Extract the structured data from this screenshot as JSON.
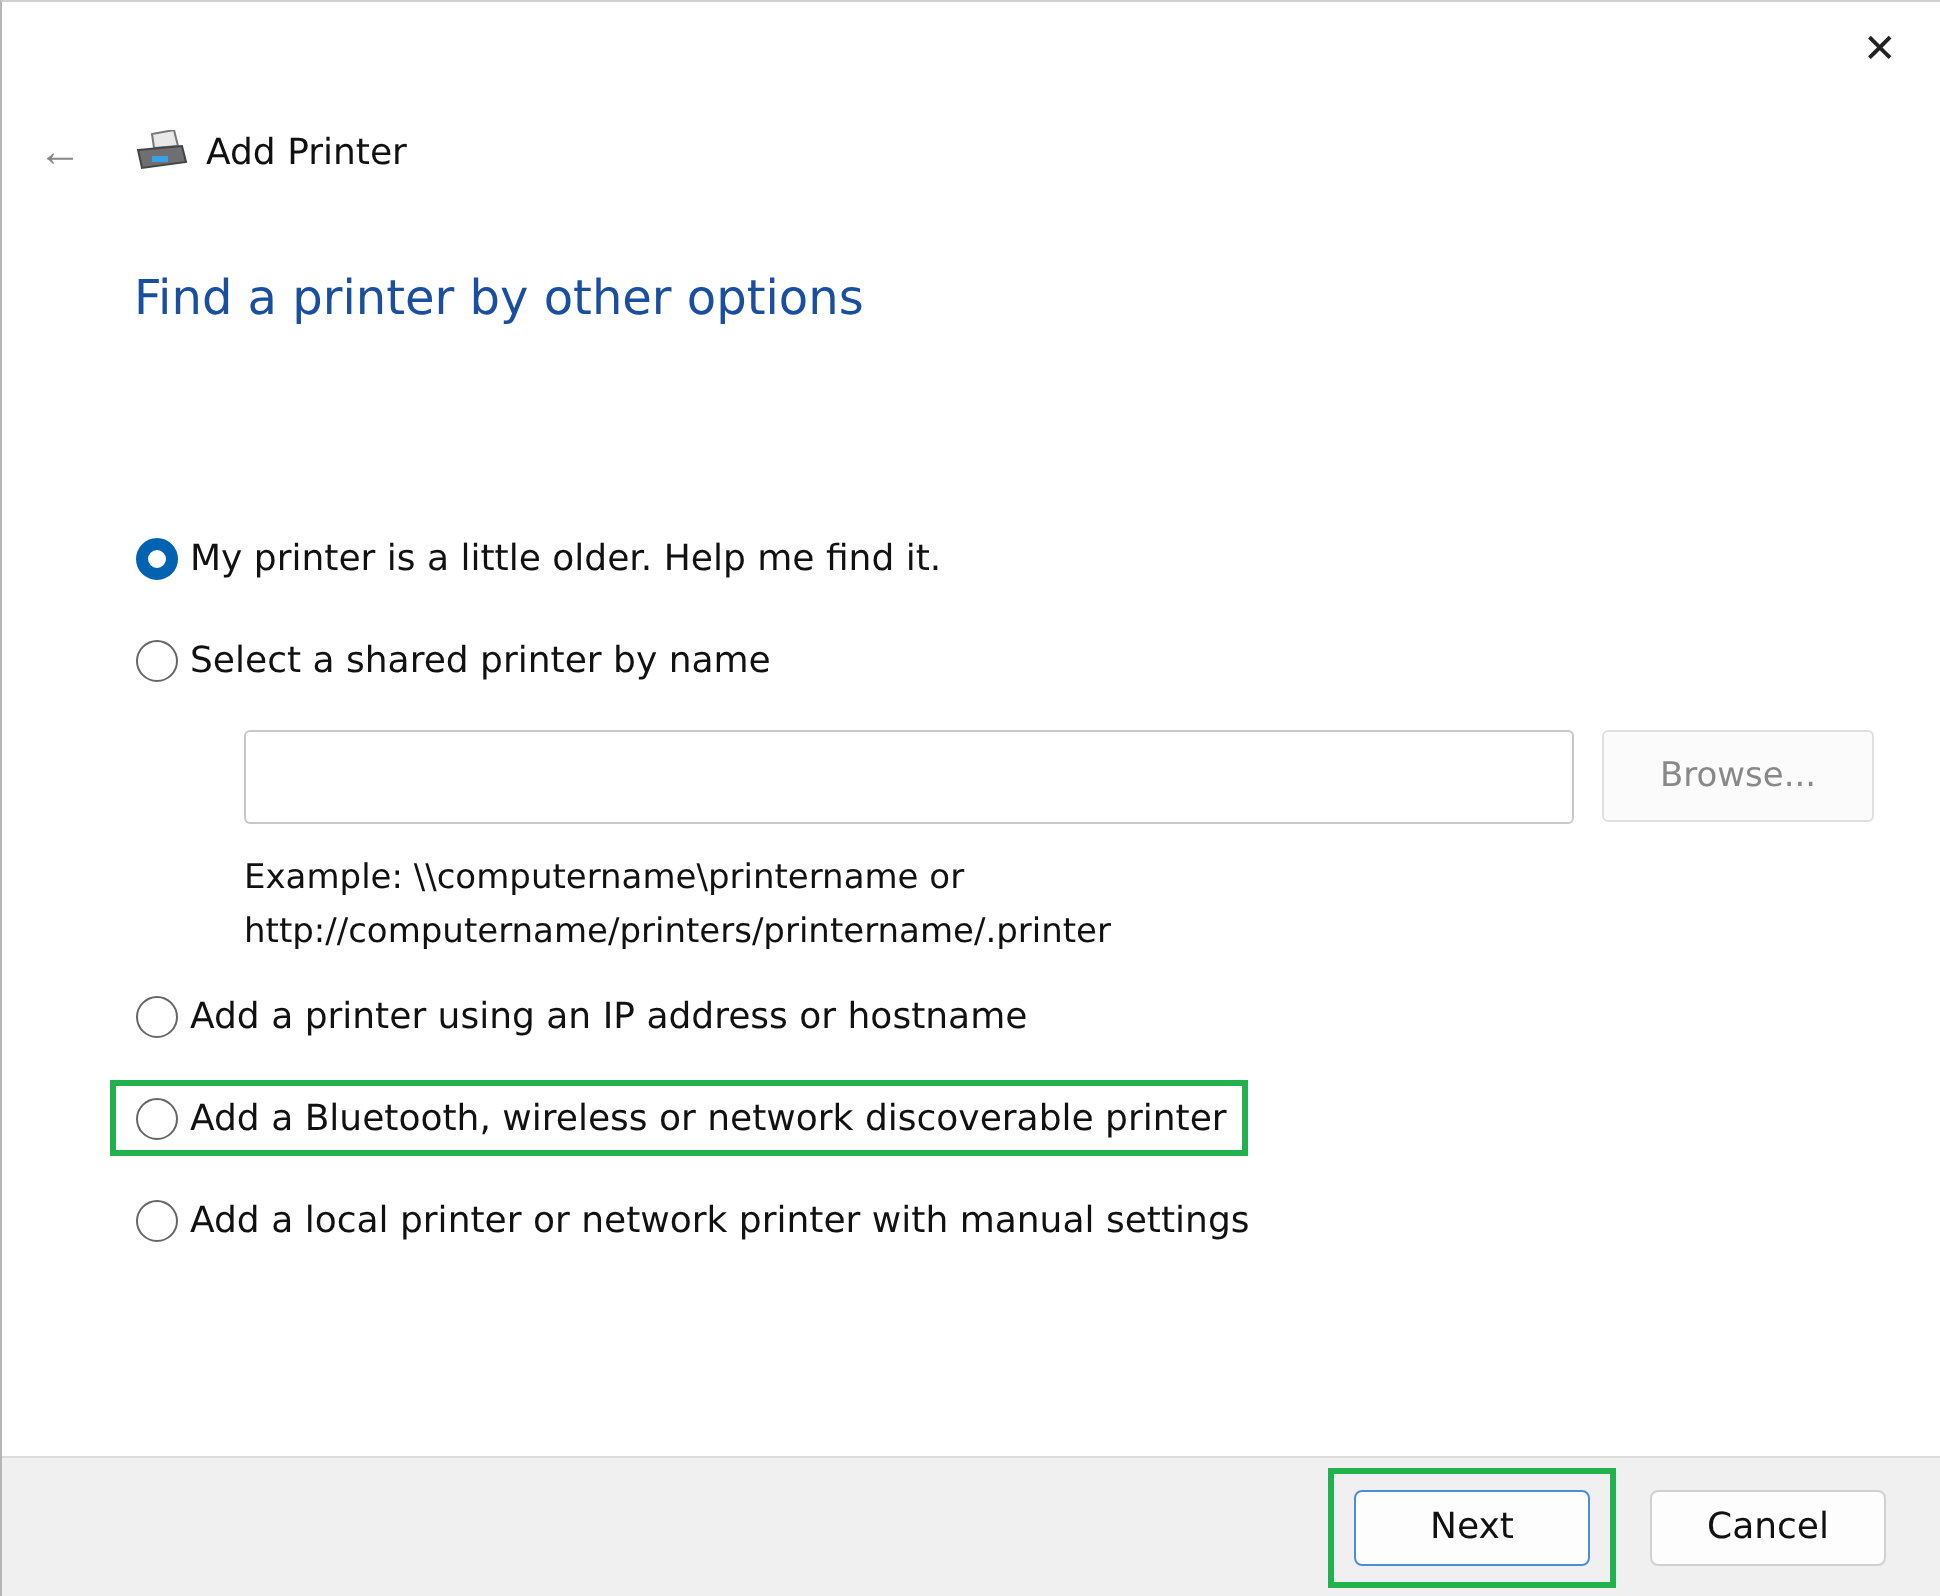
{
  "window": {
    "title": "Add Printer",
    "close_glyph": "✕",
    "back_glyph": "←"
  },
  "heading": "Find a printer by other options",
  "options": [
    {
      "label": "My printer is a little older. Help me find it.",
      "selected": true,
      "highlighted": false
    },
    {
      "label": "Select a shared printer by name",
      "selected": false,
      "highlighted": false,
      "browse": {
        "label": "Browse...",
        "disabled": true
      },
      "example": [
        "Example: \\\\computername\\printername or",
        "http://computername/printers/printername/.printer"
      ]
    },
    {
      "label": "Add a printer using an IP address or hostname",
      "selected": false,
      "highlighted": false
    },
    {
      "label": "Add a Bluetooth, wireless or network discoverable printer",
      "selected": false,
      "highlighted": true
    },
    {
      "label": "Add a local printer or network printer with manual settings",
      "selected": false,
      "highlighted": false
    }
  ],
  "buttons": [
    {
      "label": "Next",
      "default": true,
      "highlighted": true
    },
    {
      "label": "Cancel",
      "default": false,
      "highlighted": false
    }
  ]
}
